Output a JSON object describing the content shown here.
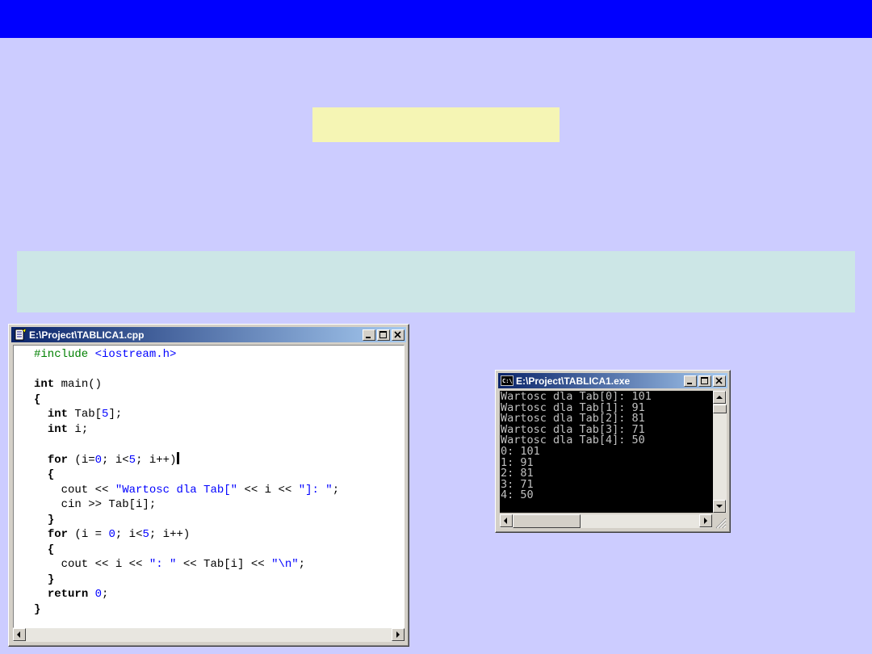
{
  "slide": {
    "colors": {
      "background": "#ccccff",
      "header_bar": "#0000ff",
      "highlight": "#f5f5b4",
      "info_box": "#cce6e6"
    }
  },
  "editor_window": {
    "title": "E:\\Project\\TABLICA1.cpp",
    "icon": "document-icon",
    "buttons": [
      "minimize-icon",
      "maximize-icon",
      "close-icon"
    ],
    "code_lines": [
      "#include <iostream.h>",
      "",
      "int main()",
      "{",
      "  int Tab[5];",
      "  int i;",
      "",
      "  for (i=0; i<5; i++)",
      "  {",
      "    cout << \"Wartosc dla Tab[\" << i << \"]: \";",
      "    cin >> Tab[i];",
      "  }",
      "  for (i = 0; i<5; i++)",
      "  {",
      "    cout << i << \": \" << Tab[i] << \"\\n\";",
      "  }",
      "  return 0;",
      "}"
    ]
  },
  "console_window": {
    "title": "E:\\Project\\TABLICA1.exe",
    "icon": "console-icon",
    "buttons": [
      "minimize-icon",
      "maximize-icon",
      "close-icon"
    ],
    "output_lines": [
      "Wartosc dla Tab[0]: 101",
      "Wartosc dla Tab[1]: 91",
      "Wartosc dla Tab[2]: 81",
      "Wartosc dla Tab[3]: 71",
      "Wartosc dla Tab[4]: 50",
      "0: 101",
      "1: 91",
      "2: 81",
      "3: 71",
      "4: 50"
    ]
  }
}
